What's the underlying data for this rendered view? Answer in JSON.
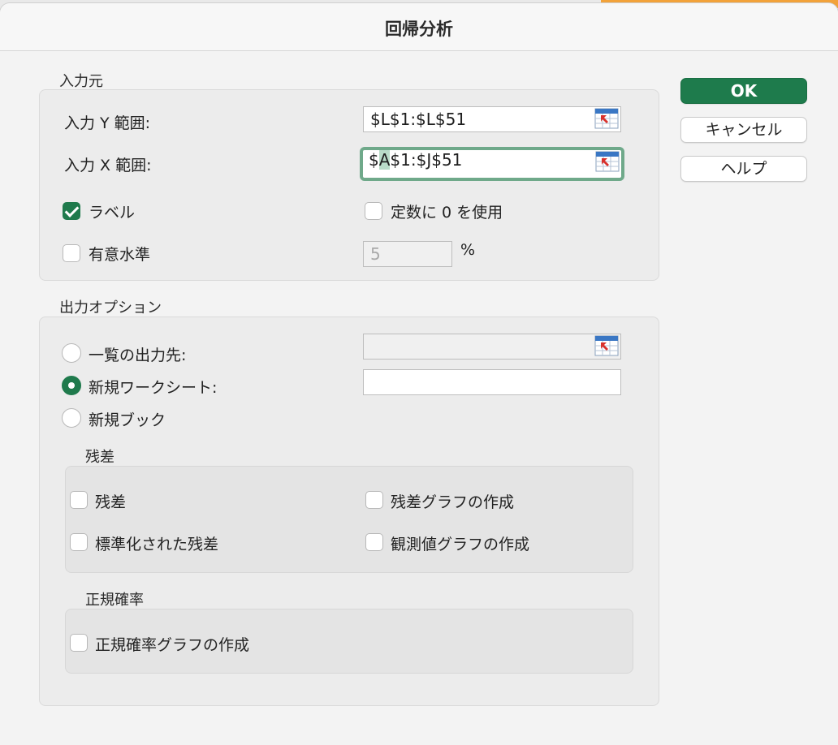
{
  "dialog": {
    "title": "回帰分析"
  },
  "buttons": {
    "ok": "OK",
    "cancel": "キャンセル",
    "help": "ヘルプ"
  },
  "input": {
    "group_label": "入力元",
    "y_range_label": "入力 Y 範囲:",
    "y_range_value": "$L$1:$L$51",
    "x_range_label": "入力 X 範囲:",
    "x_range_value_pre": "$",
    "x_range_value_hl": "A",
    "x_range_value_post": "$1:$J$51",
    "labels_checkbox": {
      "label": "ラベル",
      "checked": true
    },
    "constant_zero_checkbox": {
      "label": "定数に 0 を使用",
      "checked": false
    },
    "confidence_checkbox": {
      "label": "有意水準",
      "checked": false
    },
    "confidence_value": "5",
    "percent_sign": "%"
  },
  "output": {
    "group_label": "出力オプション",
    "output_range": {
      "label": "一覧の出力先:",
      "selected": false,
      "value": ""
    },
    "new_worksheet": {
      "label": "新規ワークシート:",
      "selected": true,
      "value": ""
    },
    "new_workbook": {
      "label": "新規ブック",
      "selected": false
    }
  },
  "residuals": {
    "group_label": "残差",
    "residuals": {
      "label": "残差",
      "checked": false
    },
    "residual_plots": {
      "label": "残差グラフの作成",
      "checked": false
    },
    "standardized_residuals": {
      "label": "標準化された残差",
      "checked": false
    },
    "line_fit_plots": {
      "label": "観測値グラフの作成",
      "checked": false
    }
  },
  "normal_probability": {
    "group_label": "正規確率",
    "normal_probability_plots": {
      "label": "正規確率グラフの作成",
      "checked": false
    }
  },
  "colors": {
    "accent": "#1e7b4c",
    "focus_ring": "#6fa98a"
  },
  "icons": {
    "range_selector": "range-select-icon"
  }
}
